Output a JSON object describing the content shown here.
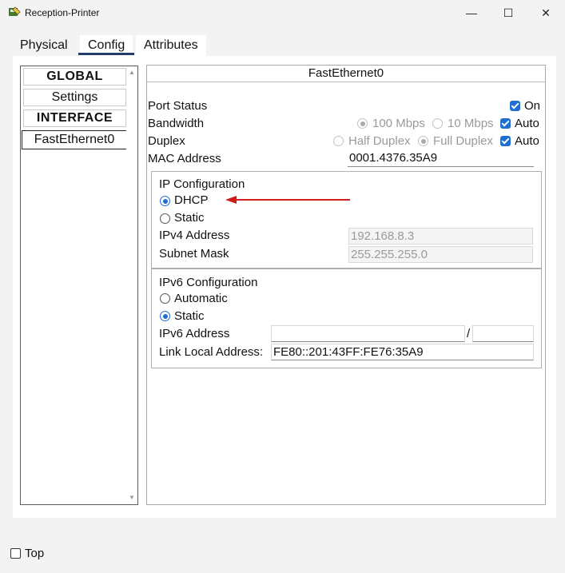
{
  "window": {
    "title": "Reception-Printer",
    "min_symbol": "—",
    "max_symbol": "☐",
    "close_symbol": "✕"
  },
  "tabs": [
    {
      "label": "Physical"
    },
    {
      "label": "Config"
    },
    {
      "label": "Attributes"
    }
  ],
  "nav": {
    "items": [
      {
        "label": "GLOBAL",
        "header": true
      },
      {
        "label": "Settings"
      },
      {
        "label": "INTERFACE",
        "header": true
      },
      {
        "label": "FastEthernet0",
        "selected": true
      }
    ]
  },
  "panel": {
    "title": "FastEthernet0",
    "port_status": {
      "label": "Port Status",
      "on_label": "On",
      "on_checked": true
    },
    "bandwidth": {
      "label": "Bandwidth",
      "opt1": "100 Mbps",
      "opt2": "10 Mbps",
      "auto_label": "Auto",
      "auto_checked": true
    },
    "duplex": {
      "label": "Duplex",
      "opt1": "Half Duplex",
      "opt2": "Full Duplex",
      "auto_label": "Auto",
      "auto_checked": true
    },
    "mac": {
      "label": "MAC Address",
      "value": "0001.4376.35A9"
    },
    "ipv4": {
      "heading": "IP Configuration",
      "dhcp_label": "DHCP",
      "static_label": "Static",
      "selected": "DHCP",
      "address_label": "IPv4 Address",
      "address_value": "192.168.8.3",
      "mask_label": "Subnet Mask",
      "mask_value": "255.255.255.0"
    },
    "ipv6": {
      "heading": "IPv6 Configuration",
      "auto_label": "Automatic",
      "static_label": "Static",
      "selected": "Static",
      "address_label": "IPv6 Address",
      "address_value": "",
      "prefix_sep": "/",
      "prefix_value": "",
      "link_local_label": "Link Local Address:",
      "link_local_value": "FE80::201:43FF:FE76:35A9"
    }
  },
  "footer": {
    "top_label": "Top",
    "top_checked": false
  },
  "colors": {
    "accent": "#1e6fd0",
    "annotation_arrow": "#d11a1a",
    "tab_underline": "#1f3c6b"
  }
}
